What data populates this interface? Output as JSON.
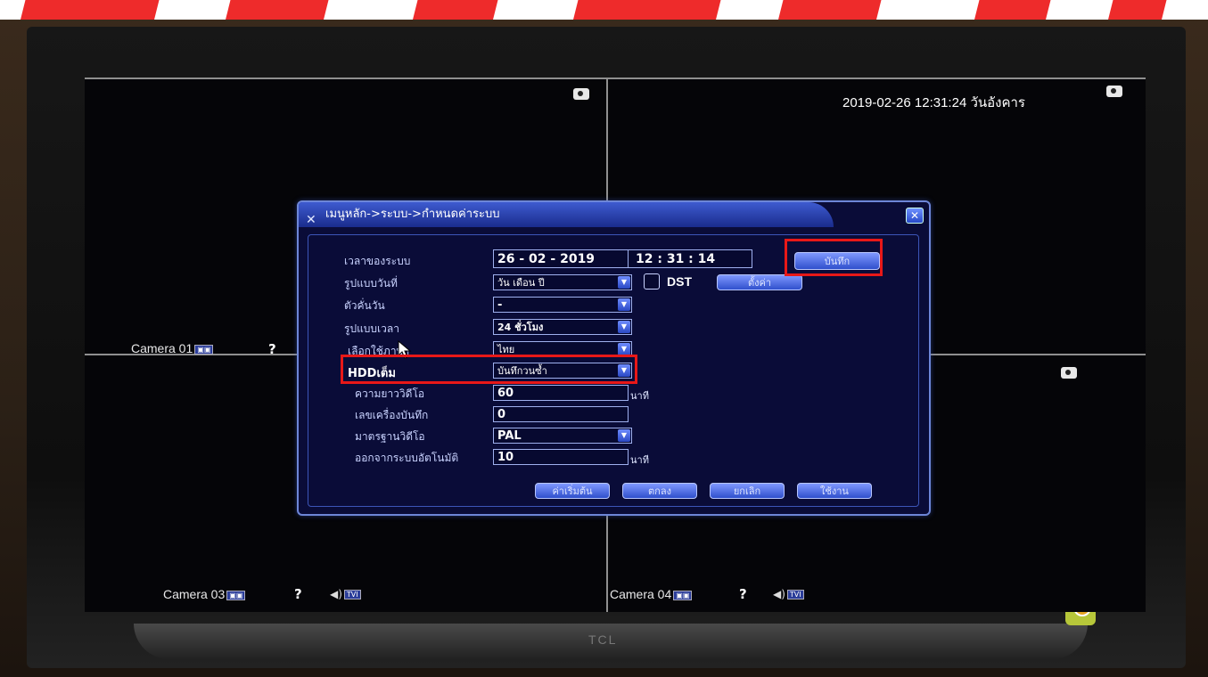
{
  "overlay": {
    "datetime": "2019-02-26 12:31:24 วันอังคาร",
    "cameras": [
      {
        "label": "Camera 01",
        "tag": "▣▣"
      },
      {
        "label": "Camera 03",
        "tag": "▣▣",
        "tvi": "TVI"
      },
      {
        "label": "Camera 04",
        "tag": "▣▣",
        "tvi": "TVI"
      }
    ],
    "unknown_icon": "?",
    "speaker_icon": "speaker-icon",
    "camera_snapshot_icon": "camera-icon"
  },
  "tv": {
    "brand": "TCL"
  },
  "dialog": {
    "title": "เมนูหลัก->ระบบ->กำหนดค่าระบบ",
    "title_icon": "tools-icon",
    "close_label": "✕",
    "fields": {
      "system_time": {
        "label": "เวลาของระบบ",
        "date": "26 - 02 - 2019",
        "time": "12 : 31 : 14"
      },
      "date_format": {
        "label": "รูปแบบวันที่",
        "value": "วัน เดือน ปี"
      },
      "date_separator": {
        "label": "ตัวคั่นวัน",
        "value": "-"
      },
      "time_format": {
        "label": "รูปแบบเวลา",
        "value": "24 ชั่วโมง"
      },
      "language": {
        "label": "เลือกใช้ภาษา",
        "value": "ไทย"
      },
      "hdd_full": {
        "label": "HDDเต็ม",
        "value": "บันทึกวนซ้ำ"
      },
      "video_length": {
        "label": "ความยาววิดีโอ",
        "value": "60",
        "unit": "นาที"
      },
      "device_no": {
        "label": "เลขเครื่องบันทึก",
        "value": "0"
      },
      "video_standard": {
        "label": "มาตรฐานวิดีโอ",
        "value": "PAL"
      },
      "auto_logout": {
        "label": "ออกจากระบบอัตโนมัติ",
        "value": "10",
        "unit": "นาที"
      }
    },
    "dst": {
      "label": "DST",
      "checked": false,
      "settings_label": "ตั้งค่า"
    },
    "save_time_label": "บันทึก",
    "buttons": {
      "default": "ค่าเริ่มต้น",
      "ok": "ตกลง",
      "cancel": "ยกเลิก",
      "apply": "ใช้งาน"
    }
  },
  "colors": {
    "highlight": "#e81818",
    "dialog_bg": "#0a0c38",
    "accent": "#3050cc"
  }
}
